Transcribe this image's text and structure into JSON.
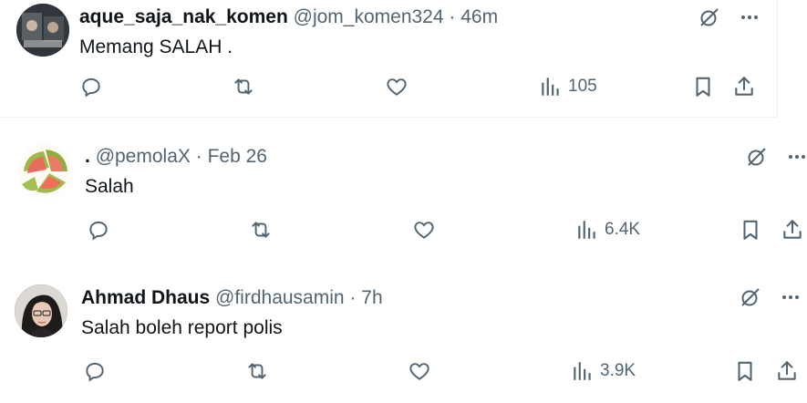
{
  "tweets": [
    {
      "name": "aque_saja_nak_komen",
      "handle": "@jom_komen324",
      "separator": "·",
      "time": "46m",
      "text": "Memang SALAH .",
      "views": "105"
    },
    {
      "name": ".",
      "handle": "@pemolaX",
      "separator": "·",
      "time": "Feb 26",
      "text": "Salah",
      "views": "6.4K"
    },
    {
      "name": "Ahmad Dhaus",
      "handle": "@firdhausamin",
      "separator": "·",
      "time": "7h",
      "text": "Salah boleh report polis",
      "views": "3.9K"
    }
  ],
  "colors": {
    "text": "#0f1419",
    "secondary": "#536471",
    "divider": "#eff3f4"
  }
}
